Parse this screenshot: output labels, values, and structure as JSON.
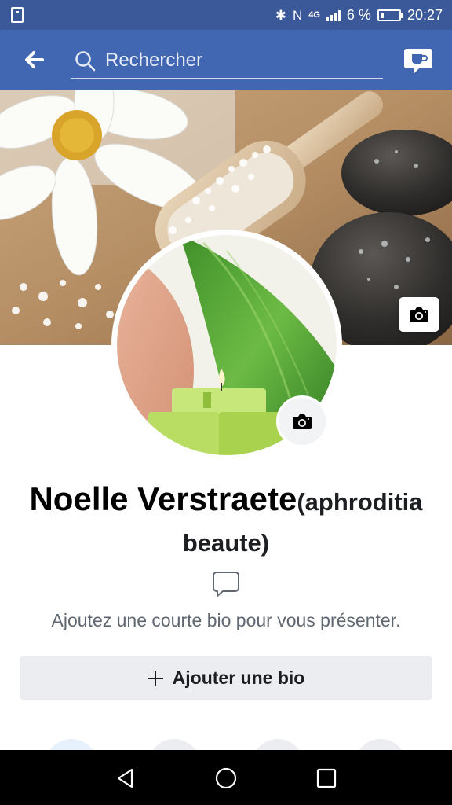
{
  "status_bar": {
    "network": "4G",
    "battery_percent": "6 %",
    "time": "20:27"
  },
  "app_bar": {
    "search_placeholder": "Rechercher"
  },
  "profile": {
    "name": "Noelle Verstraete",
    "alternate_name": "(aphroditia beaute)",
    "bio_hint": "Ajoutez une courte bio pour vous présenter.",
    "add_bio_label": "Ajouter une bio"
  },
  "icons": {
    "back": "arrow-left-icon",
    "search": "search-icon",
    "messenger": "messenger-icon",
    "camera": "camera-icon",
    "bio": "speech-bubble-icon",
    "plus": "plus-icon"
  },
  "colors": {
    "brand_blue": "#4267b2",
    "status_blue": "#3b5998",
    "button_grey": "#ebedf0",
    "hint_grey": "#606770"
  }
}
